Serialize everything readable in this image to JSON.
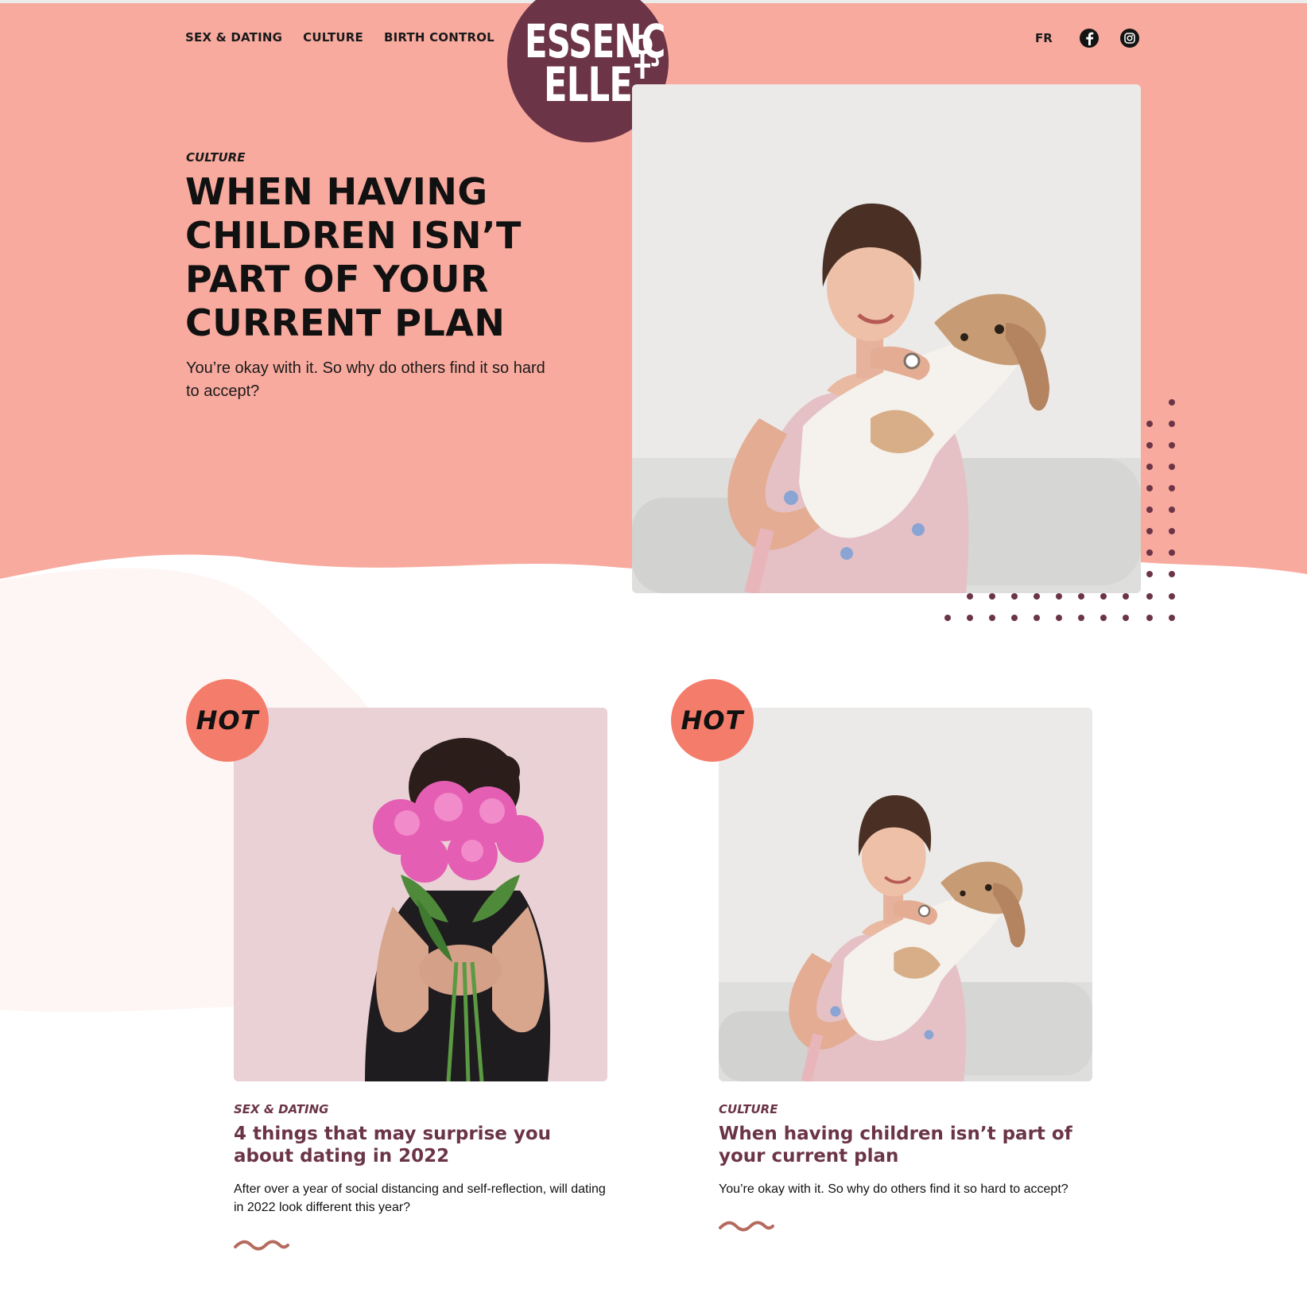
{
  "colors": {
    "hero_bg": "#f8aa9e",
    "brand": "#6b3447",
    "hot_badge": "#f47c6a",
    "text_dark": "#111111",
    "squiggle": "#b56a5e"
  },
  "nav": {
    "items": [
      {
        "label": "SEX & DATING"
      },
      {
        "label": "CULTURE"
      },
      {
        "label": "BIRTH CONTROL"
      }
    ],
    "language": "FR",
    "social": [
      {
        "icon": "facebook-icon"
      },
      {
        "icon": "instagram-icon"
      }
    ]
  },
  "logo": {
    "line1": "ESSENÇ",
    "line2": "ELLE"
  },
  "hero": {
    "category": "CULTURE",
    "title": "When having children isn’t part of your current plan",
    "subtitle": "You’re okay with it. So why do others find it so hard to accept?",
    "image": "woman-holding-beagle-photo"
  },
  "cards": [
    {
      "badge": "HOT",
      "category": "SEX & DATING",
      "title": "4 things that may surprise you about dating in 2022",
      "description": "After over a year of social distancing and self-reflection, will dating in 2022 look different this year?",
      "image": "woman-with-peonies-photo"
    },
    {
      "badge": "HOT",
      "category": "CULTURE",
      "title": "When having children isn’t part of your current plan",
      "description": "You’re okay with it. So why do others find it so hard to accept?",
      "image": "woman-holding-beagle-photo"
    }
  ]
}
